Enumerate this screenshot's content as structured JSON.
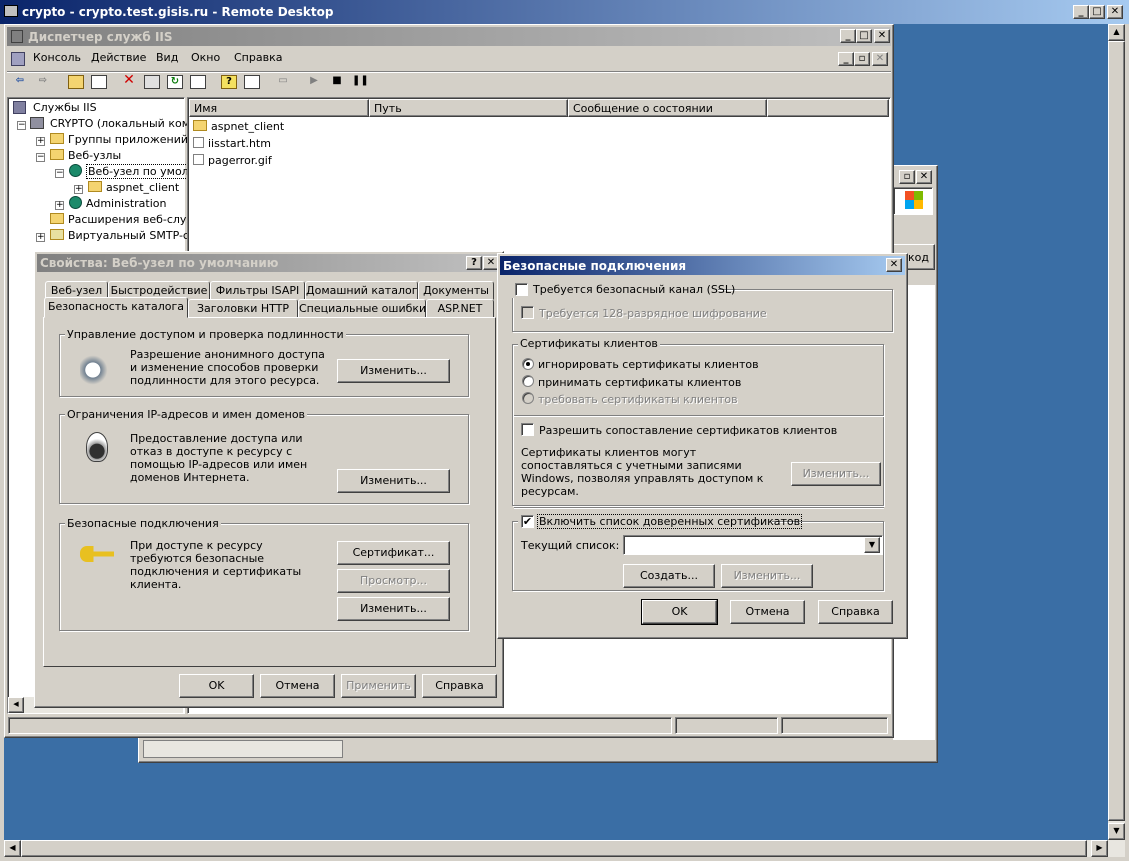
{
  "rdp": {
    "title": "crypto - crypto.test.gisis.ru - Remote Desktop"
  },
  "iis": {
    "title": "Диспетчер служб IIS",
    "menu": [
      "Консоль",
      "Действие",
      "Вид",
      "Окно",
      "Справка"
    ],
    "tree": [
      "Службы IIS",
      "CRYPTO (локальный компьютер)",
      "Группы приложений",
      "Веб-узлы",
      "Веб-узел по умолчанию",
      "aspnet_client",
      "Administration",
      "Расширения веб-служб",
      "Виртуальный SMTP-сервер"
    ],
    "columns": [
      "Имя",
      "Путь",
      "Сообщение о состоянии"
    ],
    "files": [
      "aspnet_client",
      "iisstart.htm",
      "pagerror.gif"
    ]
  },
  "bg_window": {
    "partial_header": "код"
  },
  "props": {
    "title": "Свойства: Веб-узел по умолчанию",
    "tabs_row1": [
      "Веб-узел",
      "Быстродействие",
      "Фильтры ISAPI",
      "Домашний каталог",
      "Документы"
    ],
    "tabs_row2": [
      "Безопасность каталога",
      "Заголовки HTTP",
      "Специальные ошибки",
      "ASP.NET"
    ],
    "g1": {
      "title": "Управление доступом и проверка подлинности",
      "text": "Разрешение анонимного доступа и изменение способов проверки подлинности для этого ресурса.",
      "btn": "Изменить..."
    },
    "g2": {
      "title": "Ограничения IP-адресов и имен доменов",
      "text": "Предоставление доступа или отказ в доступе к ресурсу с помощью IP-адресов или имен доменов Интернета.",
      "btn": "Изменить..."
    },
    "g3": {
      "title": "Безопасные подключения",
      "text": "При доступе к ресурсу требуются безопасные подключения и сертификаты клиента.",
      "btn1": "Сертификат...",
      "btn2": "Просмотр...",
      "btn3": "Изменить..."
    },
    "ok": "OK",
    "cancel": "Отмена",
    "apply": "Применить",
    "help": "Справка"
  },
  "ssl": {
    "title": "Безопасные подключения",
    "require_ssl": "Требуется безопасный канал (SSL)",
    "require_128": "Требуется 128-разрядное шифрование",
    "certs_group": "Сертификаты клиентов",
    "opt_ignore": "игнорировать сертификаты клиентов",
    "opt_accept": "принимать сертификаты клиентов",
    "opt_require": "требовать сертификаты клиентов",
    "mapping_chk": "Разрешить сопоставление сертификатов клиентов",
    "mapping_text": "Сертификаты клиентов могут сопоставляться с учетными записями Windows, позволяя управлять доступом к ресурсам.",
    "mapping_btn": "Изменить...",
    "ctl_chk": "Включить список доверенных сертификатов",
    "current_list_label": "Текущий список:",
    "current_list_value": "",
    "create_btn": "Создать...",
    "edit_btn": "Изменить...",
    "ok": "OK",
    "cancel": "Отмена",
    "help": "Справка"
  }
}
